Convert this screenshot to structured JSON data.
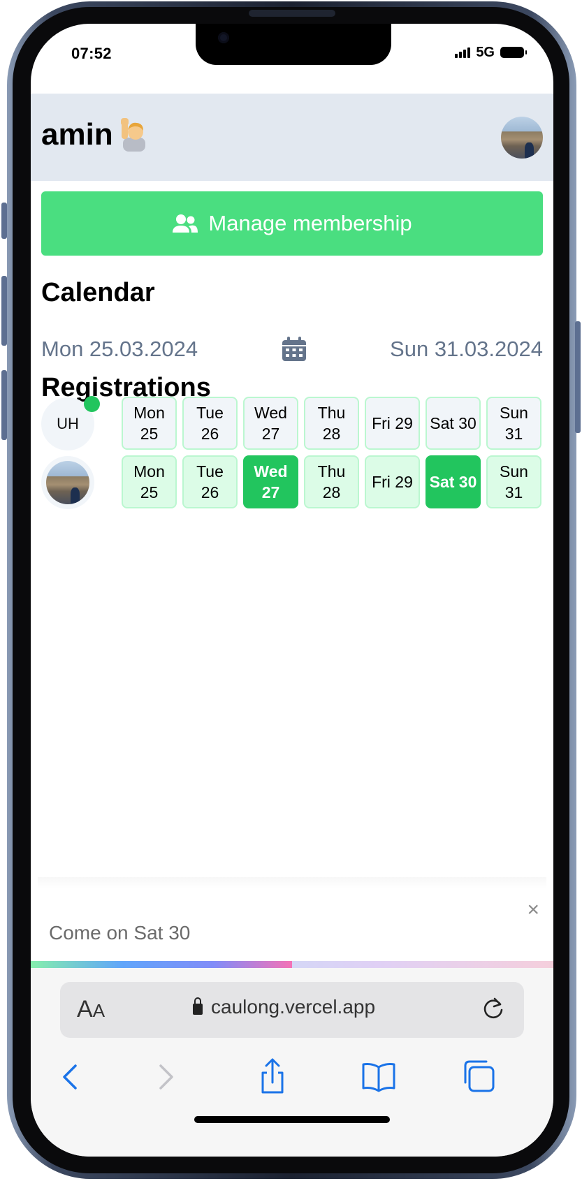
{
  "status_bar": {
    "time": "07:52",
    "network": "5G"
  },
  "header": {
    "username": "amin",
    "wave_emoji": "🙋‍♂️"
  },
  "manage_button": {
    "label": "Manage membership"
  },
  "calendar": {
    "title": "Calendar",
    "start_date": "Mon 25.03.2024",
    "end_date": "Sun 31.03.2024"
  },
  "registrations": {
    "title": "Registrations",
    "rows": [
      {
        "avatar_initials": "UH",
        "online": true,
        "days": [
          {
            "label": "Mon 25",
            "selected": false
          },
          {
            "label": "Tue 26",
            "selected": false
          },
          {
            "label": "Wed 27",
            "selected": false
          },
          {
            "label": "Thu 28",
            "selected": false
          },
          {
            "label": "Fri 29",
            "selected": false
          },
          {
            "label": "Sat 30",
            "selected": false
          },
          {
            "label": "Sun 31",
            "selected": false
          }
        ]
      },
      {
        "avatar_initials": "",
        "online": false,
        "days": [
          {
            "label": "Mon 25",
            "selected": false
          },
          {
            "label": "Tue 26",
            "selected": false
          },
          {
            "label": "Wed 27",
            "selected": true
          },
          {
            "label": "Thu 28",
            "selected": false
          },
          {
            "label": "Fri 29",
            "selected": false
          },
          {
            "label": "Sat 30",
            "selected": true
          },
          {
            "label": "Sun 31",
            "selected": false
          }
        ]
      }
    ]
  },
  "toast": {
    "message": "Come on Sat 30",
    "close_symbol": "×",
    "progress": 0.5
  },
  "browser": {
    "aa_label": "AA",
    "url": "caulong.vercel.app"
  },
  "colors": {
    "accent_green": "#22c55e",
    "button_green": "#4ade80",
    "header_bg": "#e2e8f0",
    "muted_text": "#64748b",
    "safari_blue": "#1a73e8"
  }
}
